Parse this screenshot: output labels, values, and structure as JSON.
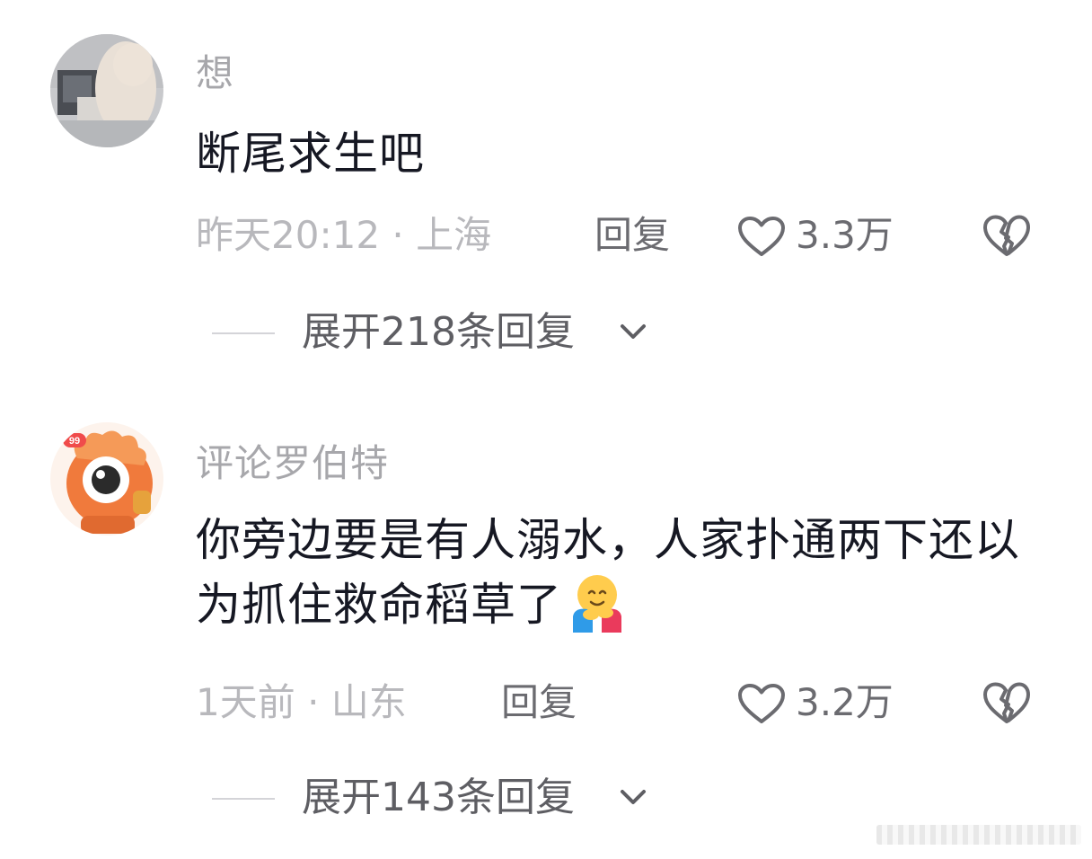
{
  "comments": [
    {
      "username": "想",
      "text": "断尾求生吧",
      "time_location": "昨天20:12 · 上海",
      "reply_label": "回复",
      "likes": "3.3万",
      "expand_label": "展开218条回复"
    },
    {
      "username": "评论罗伯特",
      "text": "你旁边要是有人溺水，人家扑通两下还以为抓住救命稻草了",
      "time_location": "1天前 · 山东",
      "reply_label": "回复",
      "likes": "3.2万",
      "expand_label": "展开143条回复",
      "avatar_badge": "99"
    }
  ],
  "icons": {
    "like": "heart-outline-icon",
    "dislike": "broken-heart-icon",
    "expand": "chevron-down-icon",
    "emoji": "hugging-face-emoji"
  },
  "colors": {
    "text_primary": "#161823",
    "text_secondary": "#a7a7ab",
    "action": "#6b6b70"
  }
}
